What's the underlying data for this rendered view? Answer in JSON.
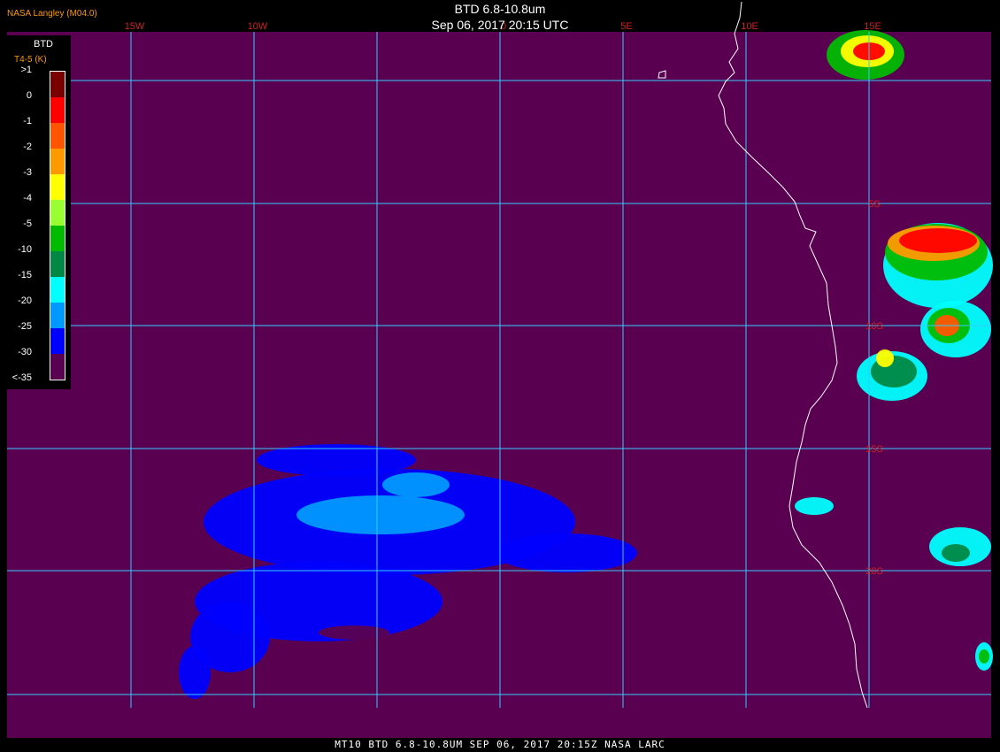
{
  "header": {
    "title": "BTD 6.8-10.8um",
    "datetime": "Sep 06, 2017 20:15 UTC",
    "agency": "NASA Langley (M04.0)"
  },
  "footer": {
    "caption": "MT10  BTD 6.8-10.8UM   SEP 06, 2017 20:15Z   NASA LARC"
  },
  "legend": {
    "title": "BTD",
    "unit": "T4-5 (K)",
    "labels": [
      ">1",
      "0",
      "-1",
      "-2",
      "-3",
      "-4",
      "-5",
      "-10",
      "-15",
      "-20",
      "-25",
      "-30",
      "<-35"
    ],
    "colors": [
      "#7a0000",
      "#ff0000",
      "#ff5500",
      "#ff9900",
      "#ffff00",
      "#99ff33",
      "#00bb00",
      "#008844",
      "#00ffff",
      "#0099ff",
      "#0000ff",
      "#5a0050"
    ]
  },
  "map": {
    "background_color": "#5a0050",
    "grid_color": "#33ccff",
    "coast_color": "#ffffff",
    "lon_labels": [
      "15W",
      "10W",
      "0",
      "5E",
      "10E",
      "15E"
    ],
    "lat_labels": [
      "5S",
      "10S",
      "15S",
      "20S"
    ]
  }
}
